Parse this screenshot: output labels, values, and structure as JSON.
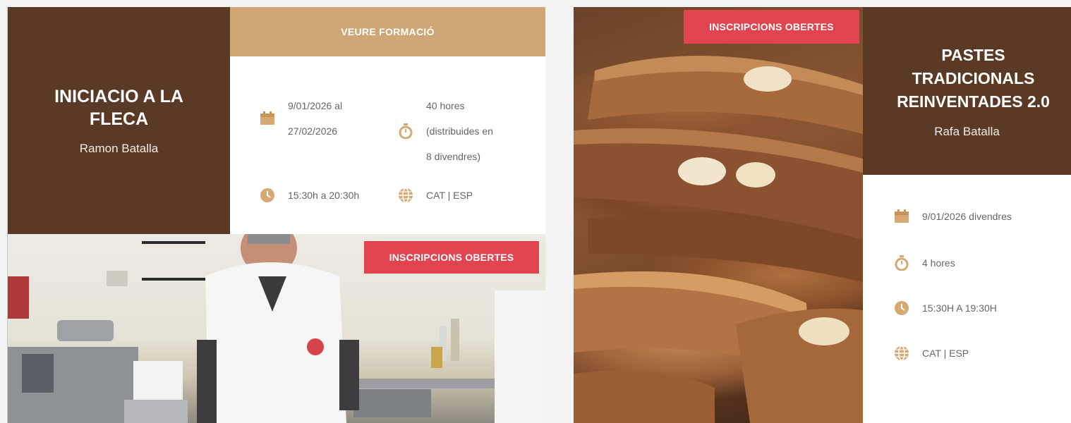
{
  "colors": {
    "brown_panel": "#5a3a25",
    "tan_button": "#cfa675",
    "badge_red": "#e1444e",
    "icon_tan": "#d6a872"
  },
  "course1": {
    "title": "INICIACIO A LA FLECA",
    "teacher": "Ramon Batalla",
    "button_label": "VEURE FORMACIÓ",
    "badge": "INSCRIPCIONS OBERTES",
    "dates": [
      "9/01/2026 al",
      "27/02/2026"
    ],
    "duration": [
      "40 hores",
      "(distribuides en",
      "8 divendres)"
    ],
    "schedule": "15:30h a 20:30h",
    "language": "CAT | ESP",
    "icons": {
      "dates": "calendar-icon",
      "duration": "stopwatch-icon",
      "schedule": "clock-icon",
      "language": "globe-icon"
    }
  },
  "course2": {
    "title": [
      "PASTES",
      "TRADICIONALS",
      "REINVENTADES 2.0"
    ],
    "teacher": "Rafa Batalla",
    "badge": "INSCRIPCIONS OBERTES",
    "dates": "9/01/2026 divendres",
    "duration": "4 hores",
    "schedule": "15:30H A 19:30H",
    "language": "CAT | ESP",
    "icons": {
      "dates": "calendar-icon",
      "duration": "stopwatch-icon",
      "schedule": "clock-icon",
      "language": "globe-icon"
    }
  }
}
